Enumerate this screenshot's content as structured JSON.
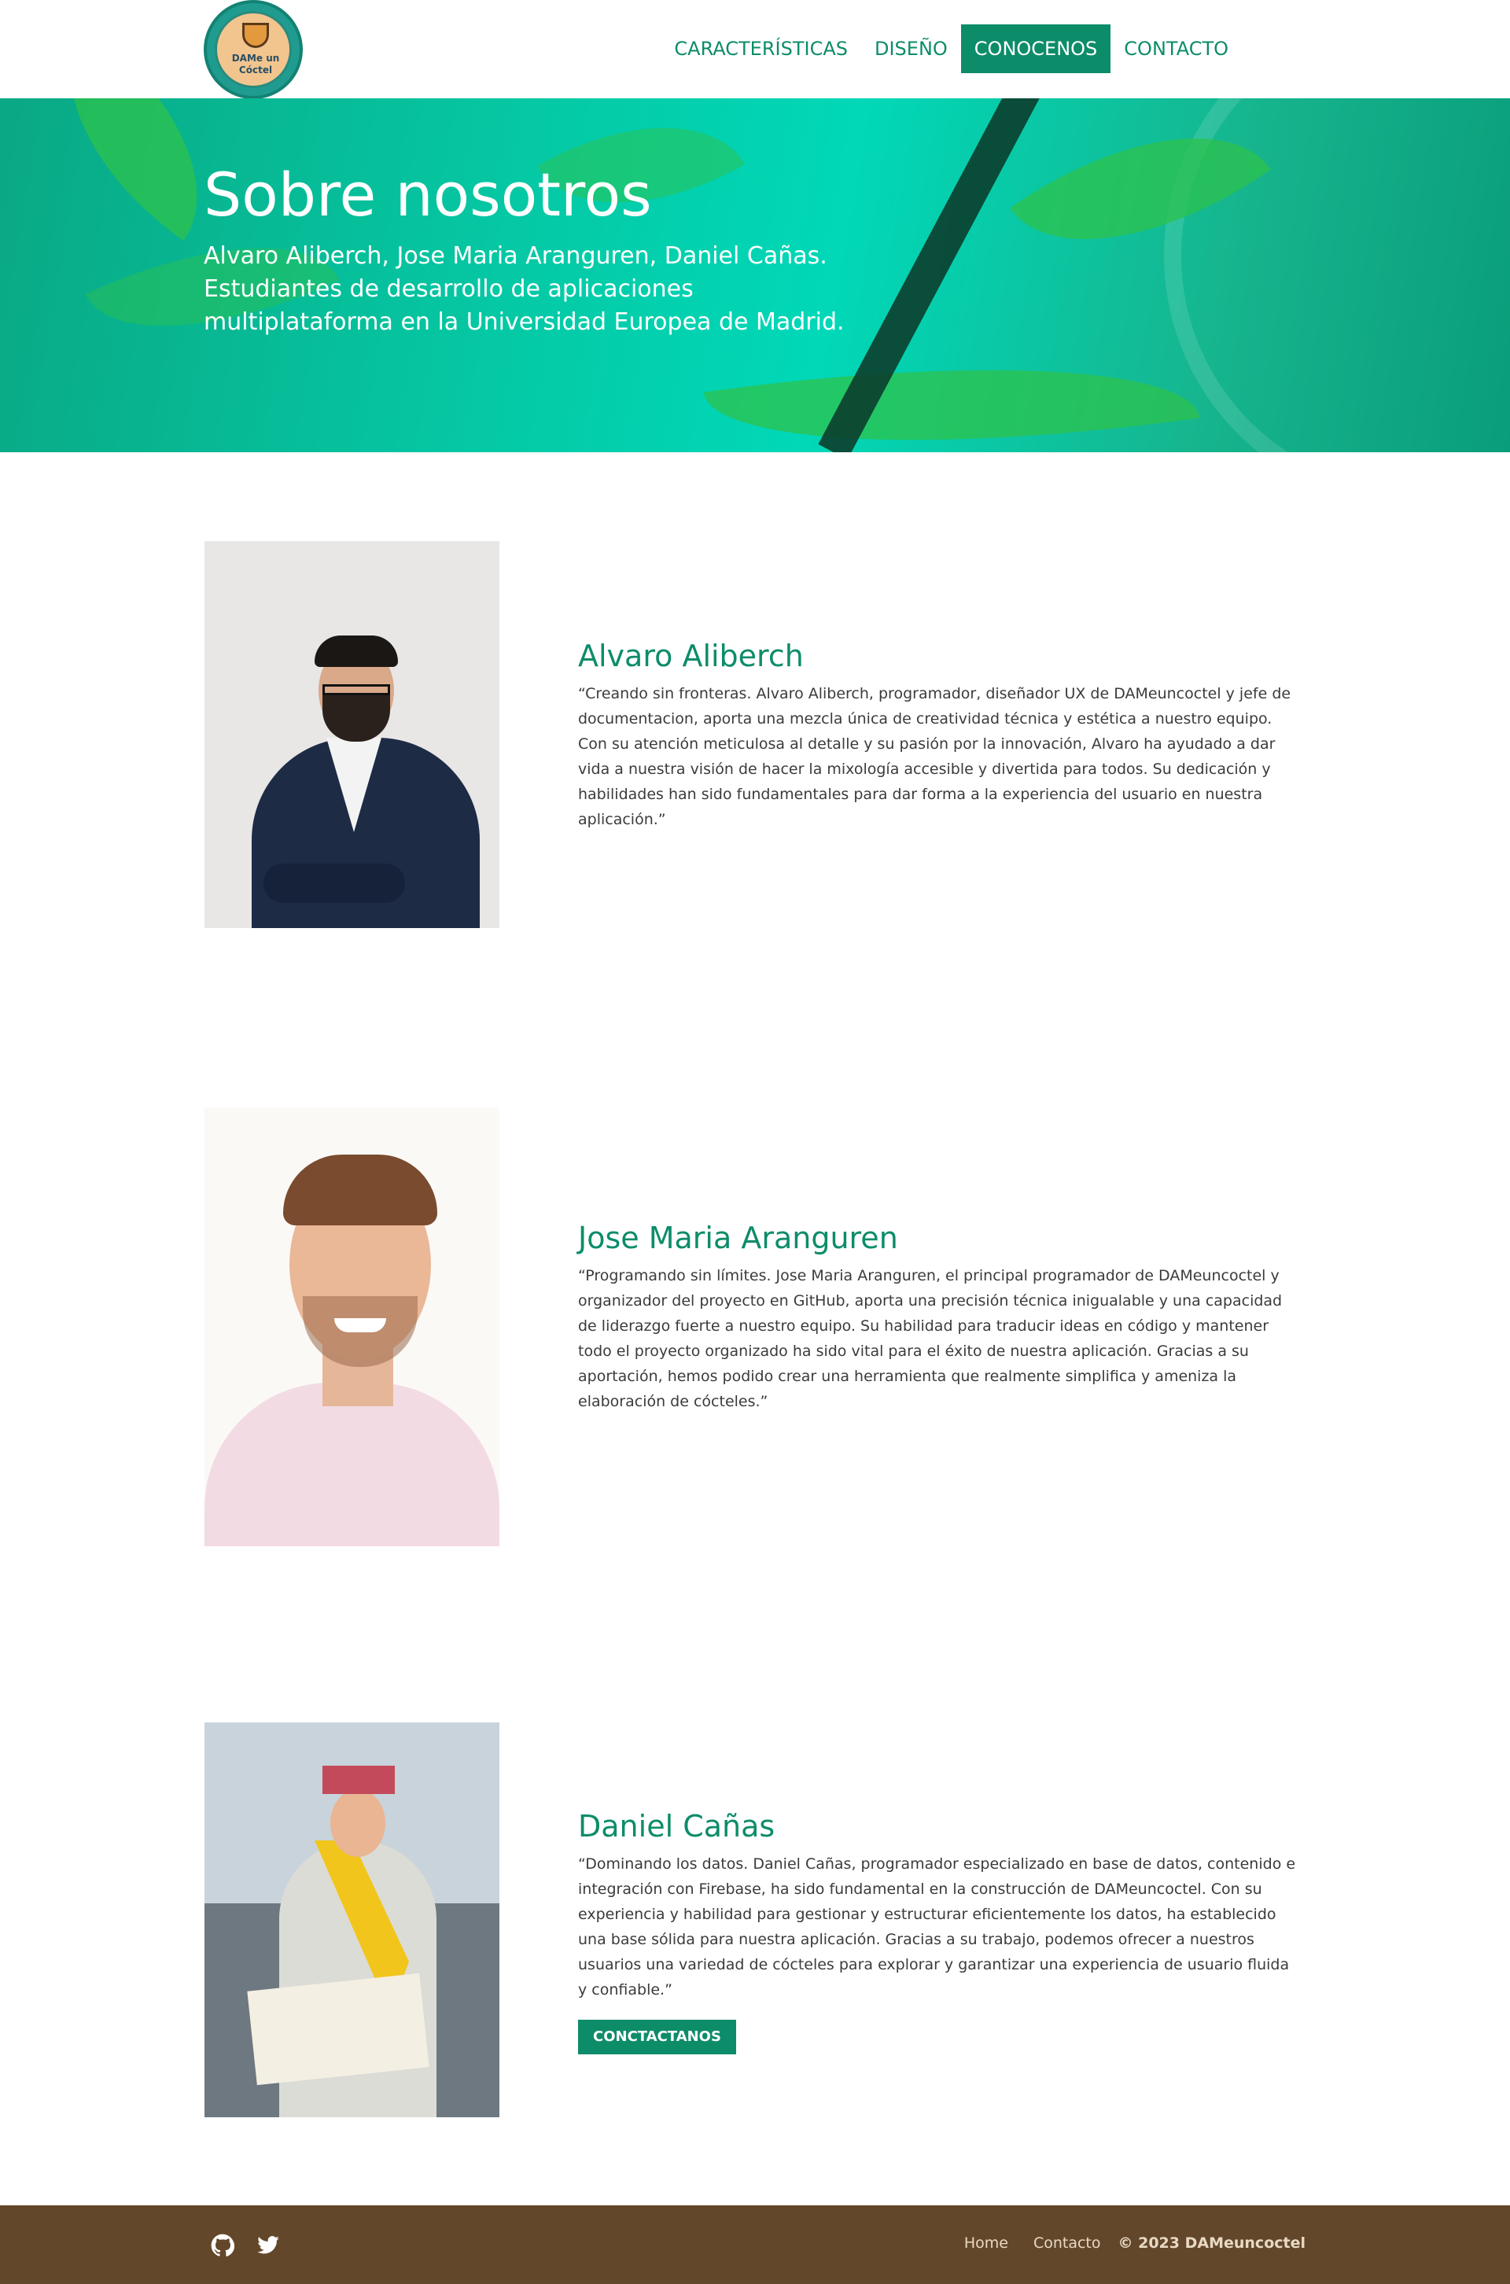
{
  "header": {
    "logo_text": "DAMe un Cóctel",
    "nav": [
      {
        "label": "CARACTERÍSTICAS"
      },
      {
        "label": "DISEÑO"
      },
      {
        "label": "CONOCENOS"
      },
      {
        "label": "CONTACTO"
      }
    ],
    "active_nav": "CONOCENOS"
  },
  "hero": {
    "title": "Sobre nosotros",
    "subtitle": "Alvaro Aliberch, Jose Maria Aranguren, Daniel Cañas. Estudiantes de desarrollo de aplicaciones multiplataforma en la Universidad Europea de Madrid."
  },
  "members": [
    {
      "name": "Alvaro Aliberch",
      "bio": "“Creando sin fronteras. Alvaro Aliberch, programador, diseñador UX de DAMeuncoctel y jefe de documentacion, aporta una mezcla única de creatividad técnica y estética a nuestro equipo. Con su atención meticulosa al detalle y su pasión por la innovación, Alvaro ha ayudado a dar vida a nuestra visión de hacer la mixología accesible y divertida para todos. Su dedicación y habilidades han sido fundamentales para dar forma a la experiencia del usuario en nuestra aplicación.”"
    },
    {
      "name": "Jose Maria Aranguren",
      "bio": "“Programando sin límites. Jose Maria Aranguren, el principal programador de DAMeuncoctel y organizador del proyecto en GitHub, aporta una precisión técnica inigualable y una capacidad de liderazgo fuerte a nuestro equipo. Su habilidad para traducir ideas en código y mantener todo el proyecto organizado ha sido vital para el éxito de nuestra aplicación. Gracias a su aportación, hemos podido crear una herramienta que realmente simplifica y ameniza la elaboración de cócteles.”"
    },
    {
      "name": "Daniel Cañas",
      "bio": "“Dominando los datos. Daniel Cañas, programador especializado en base de datos, contenido e integración con Firebase, ha sido fundamental en la construcción de DAMeuncoctel. Con su experiencia y habilidad para gestionar y estructurar eficientemente los datos, ha establecido una base sólida para nuestra aplicación. Gracias a su trabajo, podemos ofrecer a nuestros usuarios una variedad de cócteles para explorar y garantizar una experiencia de usuario fluida y confiable.”",
      "cta": "CONCTACTANOS"
    }
  ],
  "footer": {
    "social": [
      {
        "icon": "github-icon"
      },
      {
        "icon": "twitter-icon"
      }
    ],
    "links": [
      {
        "label": "Home"
      },
      {
        "label": "Contacto"
      }
    ],
    "copyright": "© 2023 DAMeuncoctel"
  },
  "colors": {
    "accent": "#0d8c6a",
    "footer": "#63472a",
    "hero": "#00d8b8"
  }
}
